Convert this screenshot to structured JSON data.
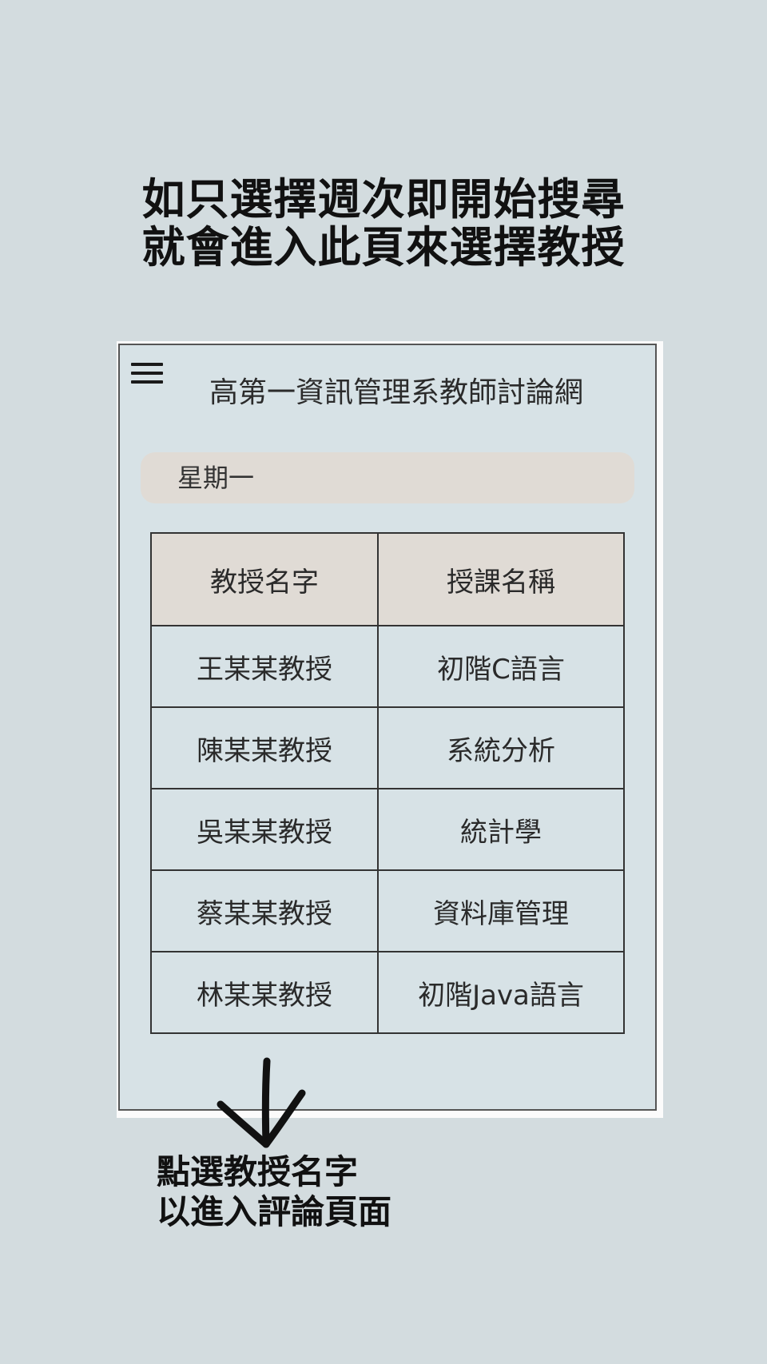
{
  "headline": {
    "line1": "如只選擇週次即開始搜尋",
    "line2": "就會進入此頁來選擇教授"
  },
  "app": {
    "menu_icon": "hamburger-menu-icon",
    "title": "高第一資訊管理系教師討論網"
  },
  "day_select": {
    "value": "星期一"
  },
  "table": {
    "headers": [
      "教授名字",
      "授課名稱"
    ],
    "rows": [
      {
        "name": "王某某教授",
        "course": "初階C語言"
      },
      {
        "name": "陳某某教授",
        "course": "系統分析"
      },
      {
        "name": "吳某某教授",
        "course": "統計學"
      },
      {
        "name": "蔡某某教授",
        "course": "資料庫管理"
      },
      {
        "name": "林某某教授",
        "course": "初階Java語言"
      }
    ]
  },
  "annotation": {
    "arrow_icon": "hand-drawn-down-arrow-icon",
    "line1": "點選教授名字",
    "line2": "以進入評論頁面"
  }
}
